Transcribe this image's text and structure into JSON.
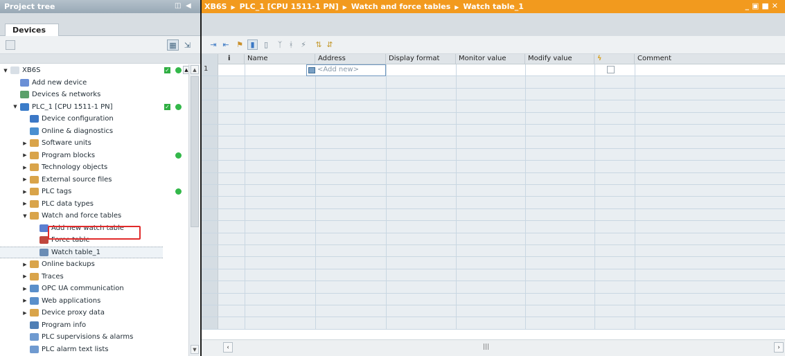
{
  "left_panel": {
    "title": "Project tree",
    "tab": "Devices",
    "tree": [
      {
        "label": "XB6S",
        "indent": 0,
        "arrow": "▼",
        "color": "#d8dfe6",
        "status": [
          "check",
          "green"
        ]
      },
      {
        "label": "Add new device",
        "indent": 1,
        "arrow": "",
        "color": "#6a8fd6"
      },
      {
        "label": "Devices & networks",
        "indent": 1,
        "arrow": "",
        "color": "#5aa06a"
      },
      {
        "label": "PLC_1 [CPU 1511-1 PN]",
        "indent": 1,
        "arrow": "▼",
        "color": "#3b7cc9",
        "status": [
          "check",
          "green"
        ]
      },
      {
        "label": "Device configuration",
        "indent": 2,
        "arrow": "",
        "color": "#3c78c6"
      },
      {
        "label": "Online & diagnostics",
        "indent": 2,
        "arrow": "",
        "color": "#4a8fd0"
      },
      {
        "label": "Software units",
        "indent": 2,
        "arrow": "▶",
        "color": "#d9a44a"
      },
      {
        "label": "Program blocks",
        "indent": 2,
        "arrow": "▶",
        "color": "#d9a44a",
        "status": [
          "green"
        ]
      },
      {
        "label": "Technology objects",
        "indent": 2,
        "arrow": "▶",
        "color": "#d9a44a"
      },
      {
        "label": "External source files",
        "indent": 2,
        "arrow": "▶",
        "color": "#d9a44a"
      },
      {
        "label": "PLC tags",
        "indent": 2,
        "arrow": "▶",
        "color": "#d9a44a",
        "status": [
          "green"
        ]
      },
      {
        "label": "PLC data types",
        "indent": 2,
        "arrow": "▶",
        "color": "#d9a44a"
      },
      {
        "label": "Watch and force tables",
        "indent": 2,
        "arrow": "▼",
        "color": "#d9a44a"
      },
      {
        "label": "Add new watch table",
        "indent": 3,
        "arrow": "",
        "color": "#5b7fd1"
      },
      {
        "label": "Force table",
        "indent": 3,
        "arrow": "",
        "color": "#c0473e"
      },
      {
        "label": "Watch table_1",
        "indent": 3,
        "arrow": "",
        "color": "#6b8db5",
        "selected": true
      },
      {
        "label": "Online backups",
        "indent": 2,
        "arrow": "▶",
        "color": "#d9a44a"
      },
      {
        "label": "Traces",
        "indent": 2,
        "arrow": "▶",
        "color": "#d9a44a"
      },
      {
        "label": "OPC UA communication",
        "indent": 2,
        "arrow": "▶",
        "color": "#5a8fca"
      },
      {
        "label": "Web applications",
        "indent": 2,
        "arrow": "▶",
        "color": "#5a8fca"
      },
      {
        "label": "Device proxy data",
        "indent": 2,
        "arrow": "▶",
        "color": "#d9a44a"
      },
      {
        "label": "Program info",
        "indent": 2,
        "arrow": "",
        "color": "#4f7fb5"
      },
      {
        "label": "PLC supervisions & alarms",
        "indent": 2,
        "arrow": "",
        "color": "#6f9ad0"
      },
      {
        "label": "PLC alarm text lists",
        "indent": 2,
        "arrow": "",
        "color": "#6f9ad0"
      }
    ]
  },
  "editor": {
    "breadcrumb": [
      "XB6S",
      "PLC_1 [CPU 1511-1 PN]",
      "Watch and force tables",
      "Watch table_1"
    ],
    "columns": [
      {
        "key": "idx",
        "label": "i"
      },
      {
        "key": "name",
        "label": "Name"
      },
      {
        "key": "address",
        "label": "Address"
      },
      {
        "key": "display",
        "label": "Display format"
      },
      {
        "key": "monitor",
        "label": "Monitor value"
      },
      {
        "key": "modify",
        "label": "Modify value"
      },
      {
        "key": "flash",
        "label": ""
      },
      {
        "key": "comment",
        "label": "Comment"
      }
    ],
    "first_row_number": "1",
    "add_new_placeholder": "<Add new>"
  },
  "colors": {
    "accent": "#f29a1e",
    "title_bar": "#a7b6c2",
    "highlight": "#e12a2a",
    "status_green": "#33b84a"
  }
}
